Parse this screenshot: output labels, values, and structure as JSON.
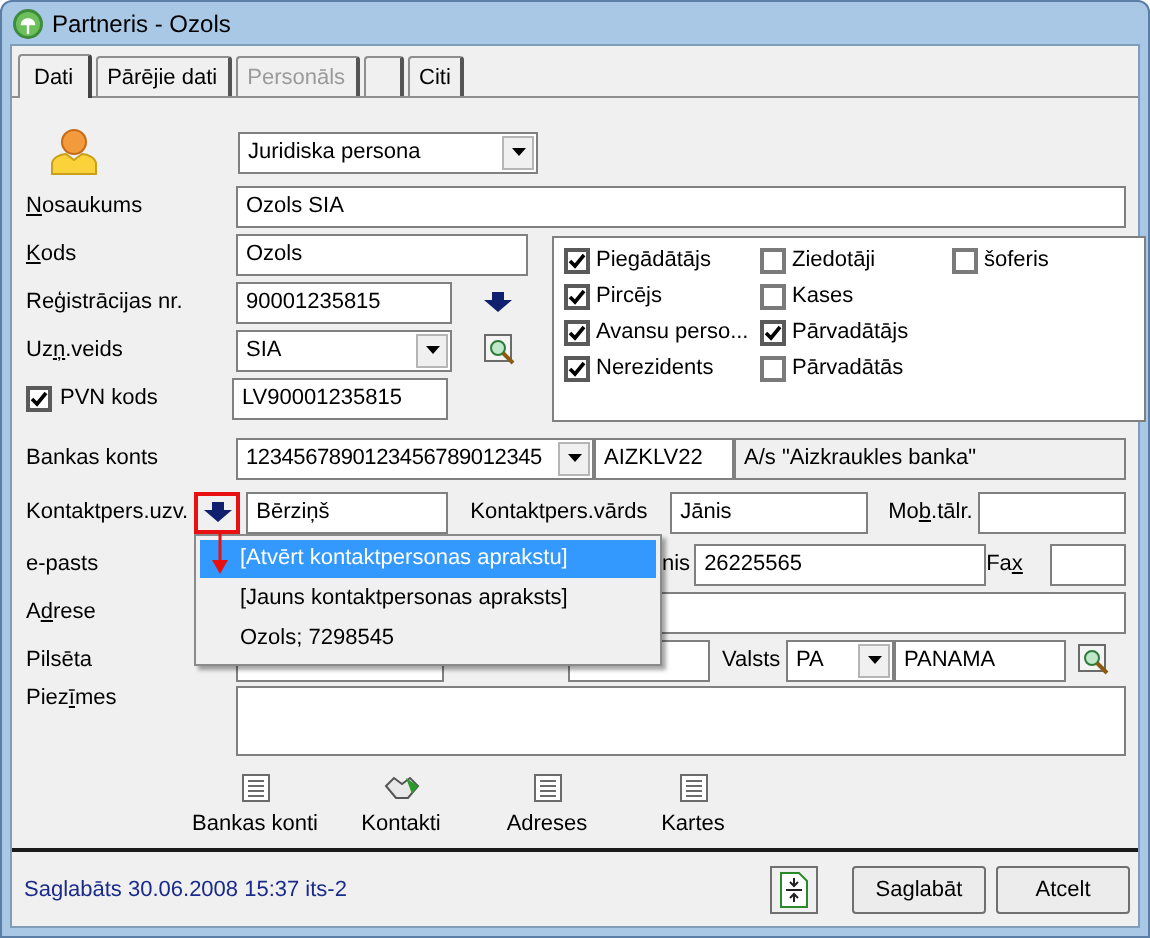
{
  "window": {
    "title": "Partneris - Ozols"
  },
  "tabs": [
    {
      "label": "Dati",
      "selected": true,
      "disabled": false
    },
    {
      "label": "Pārējie dati",
      "selected": false,
      "disabled": false
    },
    {
      "label": "Personāls",
      "selected": false,
      "disabled": true
    },
    {
      "selected": false
    },
    {
      "label": "Citi",
      "selected": false,
      "disabled": false
    }
  ],
  "partner_type": {
    "value": "Juridiska persona"
  },
  "name": {
    "label": "Nosaukums",
    "value": "Ozols SIA"
  },
  "code": {
    "label": "Kods",
    "value": "Ozols"
  },
  "reg_no": {
    "label": "Reģistrācijas nr.",
    "value": "90001235815"
  },
  "company_type": {
    "label": "Uzņ.veids",
    "value": "SIA"
  },
  "vat": {
    "label": "PVN kods",
    "checked": true,
    "value": "LV90001235815"
  },
  "categories": [
    [
      {
        "label": "Piegādātājs",
        "checked": true
      },
      {
        "label": "Pircējs",
        "checked": true
      },
      {
        "label": "Avansu perso...",
        "checked": true
      },
      {
        "label": "Nerezidents",
        "checked": true
      }
    ],
    [
      {
        "label": "Ziedotāji",
        "checked": false
      },
      {
        "label": "Kases",
        "checked": false
      },
      {
        "label": "Pārvadātājs",
        "checked": true
      },
      {
        "label": "Pārvadātās",
        "checked": false
      }
    ],
    [
      {
        "label": "šoferis",
        "checked": false
      }
    ]
  ],
  "bank": {
    "label": "Bankas konts",
    "account": "1234567890123456789012345",
    "swift": "AIZKLV22",
    "bank_name": "A/s \"Aizkraukles banka\""
  },
  "contact": {
    "label": "Kontaktpers.uzv.",
    "surname": "Bērziņš",
    "first_name_label": "Kontaktpers.vārds",
    "first_name": "Jānis",
    "mobile_label": "Mob.tālr."
  },
  "contact_menu": [
    {
      "label": "[Atvērt kontaktpersonas aprakstu]",
      "selected": true
    },
    {
      "label": "[Jauns kontaktpersonas apraksts]",
      "selected": false
    },
    {
      "label": "Ozols; 7298545",
      "selected": false
    }
  ],
  "email": {
    "label": "e-pasts",
    "phone_label": "nis",
    "phone": "26225565",
    "fax_label": "Fax"
  },
  "address": {
    "label": "Adrese"
  },
  "city": {
    "label": "Pilsēta",
    "country_label": "Valsts",
    "country_code": "PA",
    "country_name": "PANAMA"
  },
  "notes": {
    "label": "Piezīmes"
  },
  "toolbar": [
    {
      "kind": "list",
      "label": "Bankas konti"
    },
    {
      "kind": "handshake",
      "label": "Kontakti"
    },
    {
      "kind": "list",
      "label": "Adreses"
    },
    {
      "kind": "list",
      "label": "Kartes"
    }
  ],
  "status": "Saglabāts 30.06.2008 15:37 its-2",
  "buttons": [
    "Saglabāt",
    "Atcelt"
  ]
}
